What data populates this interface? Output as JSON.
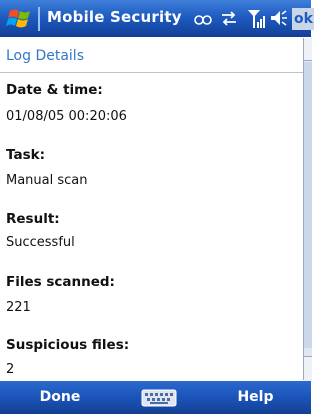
{
  "window": {
    "app_title": "Mobile Security",
    "ok_label": "ok",
    "start_icon": "windows-flag-icon",
    "tray_icons": [
      "connectivity-icon",
      "sync-arrows-icon",
      "signal-strength-icon",
      "speaker-icon"
    ]
  },
  "header": {
    "title": "Log Details"
  },
  "fields": [
    {
      "label": "Date & time:",
      "value": "01/08/05 00:20:06"
    },
    {
      "label": "Task:",
      "value": "Manual scan"
    },
    {
      "label": "Result:",
      "value": "Successful"
    },
    {
      "label": "Files scanned:",
      "value": "221"
    },
    {
      "label": "Suspicious files:",
      "value": "2"
    }
  ],
  "softkeys": {
    "left": "Done",
    "right": "Help",
    "center_icon": "keyboard-icon"
  },
  "colors": {
    "title_bar": "#1e5cc2",
    "header_text": "#2f78c8",
    "soft_bar": "#1a52b5"
  }
}
